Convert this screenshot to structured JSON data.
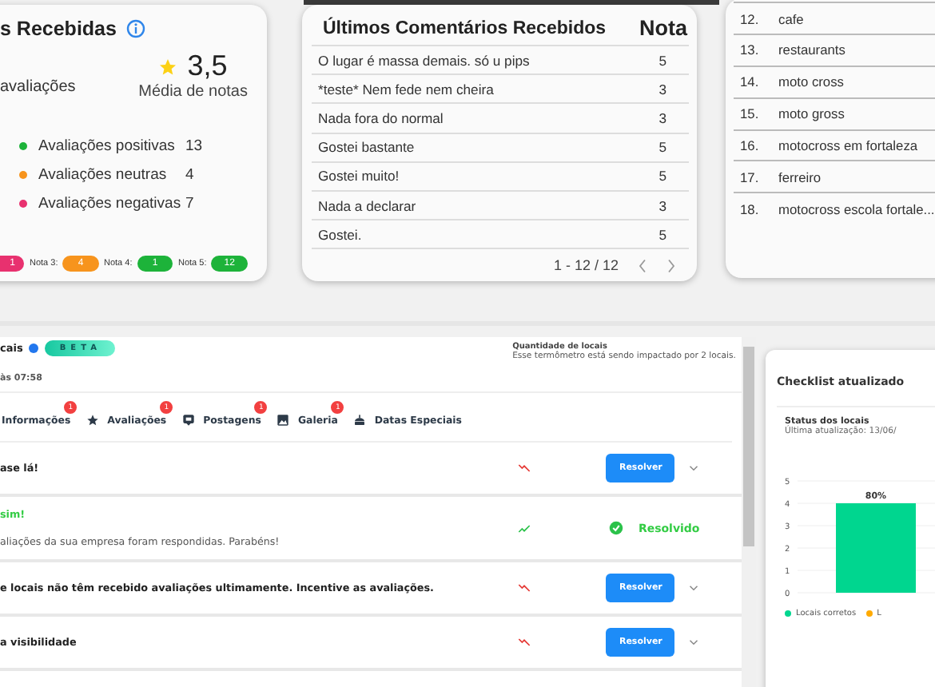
{
  "ratings_card": {
    "title": "s Recebidas",
    "total_label": "avaliações",
    "average": "3,5",
    "average_label": "Média de notas",
    "legend": [
      {
        "label": "Avaliações positivas",
        "count": "13",
        "color": "#1db33a"
      },
      {
        "label": "Avaliações neutras",
        "count": "4",
        "color": "#f7941d"
      },
      {
        "label": "Avaliações negativas",
        "count": "7",
        "color": "#e8316f"
      }
    ],
    "score_badges": [
      {
        "count": "1",
        "color": "#e8316f"
      },
      {
        "label": "Nota 3:",
        "count": "4",
        "color": "#f7941d"
      },
      {
        "label": "Nota 4:",
        "count": "1",
        "color": "#1db33a"
      },
      {
        "label": "Nota 5:",
        "count": "12",
        "color": "#1db33a"
      }
    ]
  },
  "comments_card": {
    "title": "Últimos Comentários Recebidos",
    "score_heading": "Nota",
    "rows": [
      {
        "text": "O lugar é massa demais. só u pips",
        "score": "5"
      },
      {
        "text": "*teste* Nem fede nem cheira",
        "score": "3"
      },
      {
        "text": "Nada fora do normal",
        "score": "3"
      },
      {
        "text": "Gostei bastante",
        "score": "5"
      },
      {
        "text": "Gostei muito!",
        "score": "5"
      },
      {
        "text": "Nada a declarar",
        "score": "3"
      },
      {
        "text": "Gostei.",
        "score": "5"
      }
    ],
    "pagination": "1 - 12 / 12"
  },
  "keywords_card": {
    "rows": [
      {
        "index": "12.",
        "text": "cafe"
      },
      {
        "index": "13.",
        "text": "restaurants"
      },
      {
        "index": "14.",
        "text": "moto cross"
      },
      {
        "index": "15.",
        "text": "moto gross"
      },
      {
        "index": "16.",
        "text": "motocross em fortaleza"
      },
      {
        "index": "17.",
        "text": "ferreiro"
      },
      {
        "index": "18.",
        "text": "motocross escola fortale..."
      }
    ]
  },
  "locations_panel": {
    "title": "cais",
    "badge": "BETA",
    "updated": "às 07:58",
    "count_heading": "Quantidade de locais",
    "count_note": "Esse termômetro está sendo impactado por 2 locais.",
    "tabs": [
      {
        "label": "Informações",
        "alert": "1"
      },
      {
        "label": "Avaliações",
        "alert": "1"
      },
      {
        "label": "Postagens",
        "alert": "1"
      },
      {
        "label": "Galeria",
        "alert": "1"
      },
      {
        "label": "Datas Especiais"
      }
    ],
    "tasks": [
      {
        "title": "ase lá!",
        "rising": false,
        "resolved": false,
        "action": "Resolver"
      },
      {
        "title": "sim!",
        "description": "aliações da sua empresa foram respondidas. Parabéns!",
        "rising": true,
        "resolved": true,
        "action": "Resolvido"
      },
      {
        "title": "e locais não têm recebido avaliações ultimamente. Incentive as avaliações.",
        "rising": false,
        "resolved": false,
        "action": "Resolver"
      },
      {
        "title": "a visibilidade",
        "rising": false,
        "resolved": false,
        "action": "Resolver"
      }
    ]
  },
  "checklist_card": {
    "title": "Checklist atualizado",
    "subtitle": "Status dos locais",
    "updated": "Última atualização: 13/06/",
    "chart_data": {
      "type": "bar",
      "ylim": [
        0,
        5
      ],
      "yticks": [
        0,
        1,
        2,
        3,
        4,
        5
      ],
      "series": [
        {
          "name": "Locais corretos",
          "color": "#00d68f",
          "values": [
            4
          ]
        },
        {
          "name": "L",
          "color": "#ffaa00",
          "values": [
            null
          ]
        }
      ],
      "grid": true,
      "value_labels": [
        "80%"
      ]
    }
  }
}
